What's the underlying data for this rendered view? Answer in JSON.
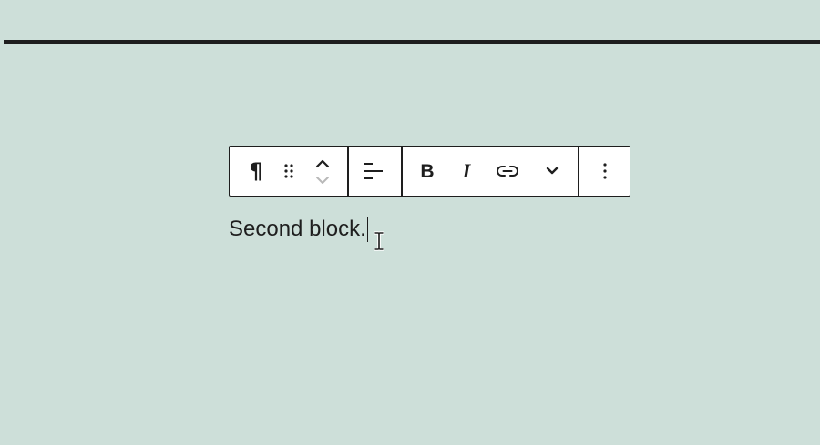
{
  "colors": {
    "background": "#cddfd9",
    "ink": "#1e1e1e",
    "toolbar_bg": "#ffffff",
    "disabled": "#b8b8b8"
  },
  "toolbar": {
    "groups": [
      {
        "name": "block-controls",
        "items": [
          {
            "name": "paragraph-block-button",
            "icon": "pilcrow-icon",
            "glyph": "¶"
          },
          {
            "name": "drag-handle",
            "icon": "drag-handle-icon"
          },
          {
            "name": "move-up-button",
            "icon": "chevron-up-icon"
          },
          {
            "name": "move-down-button",
            "icon": "chevron-down-icon",
            "disabled": true
          }
        ]
      },
      {
        "name": "alignment",
        "items": [
          {
            "name": "align-left-button",
            "icon": "align-left-icon"
          }
        ]
      },
      {
        "name": "formatting",
        "items": [
          {
            "name": "bold-button",
            "icon": "bold-icon",
            "glyph": "B"
          },
          {
            "name": "italic-button",
            "icon": "italic-icon",
            "glyph": "I"
          },
          {
            "name": "link-button",
            "icon": "link-icon"
          },
          {
            "name": "more-formatting-button",
            "icon": "chevron-down-icon"
          }
        ]
      },
      {
        "name": "options",
        "items": [
          {
            "name": "options-button",
            "icon": "more-vertical-icon"
          }
        ]
      }
    ]
  },
  "block": {
    "text": "Second block."
  }
}
